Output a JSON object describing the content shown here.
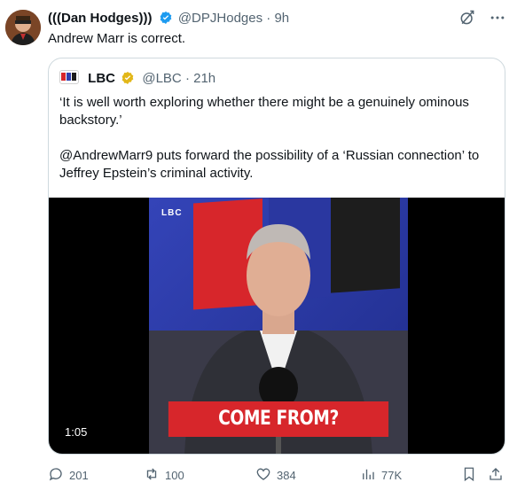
{
  "author": {
    "name": "(((Dan Hodges)))",
    "handle": "@DPJHodges",
    "separator": "·",
    "time": "9h"
  },
  "tweet": {
    "text": "Andrew Marr is correct."
  },
  "quoted": {
    "name": "LBC",
    "handle": "@LBC",
    "separator": "·",
    "time": "21h",
    "paragraphs": [
      "‘It is well worth exploring whether there might be a genuinely ominous backstory.’",
      "@AndrewMarr9 puts forward the possibility of a ‘Russian connection’ to Jeffrey Epstein’s criminal activity."
    ],
    "video": {
      "caption": "COME FROM?",
      "timestamp": "1:05",
      "logo_text": "LBC",
      "small_logo": "LBC"
    }
  },
  "actions": {
    "replies": "201",
    "reposts": "100",
    "likes": "384",
    "views": "77K"
  },
  "colors": {
    "verified_blue": "#1d9bf0",
    "verified_gold": "#e2b719",
    "lbc_red": "#d7262b",
    "lbc_blue": "#2f3fae",
    "muted": "#536471"
  },
  "icons": [
    "verified-blue-icon",
    "grok-icon",
    "more-icon",
    "verified-gold-icon",
    "reply-icon",
    "repost-icon",
    "like-icon",
    "views-icon",
    "bookmark-icon",
    "share-icon"
  ]
}
